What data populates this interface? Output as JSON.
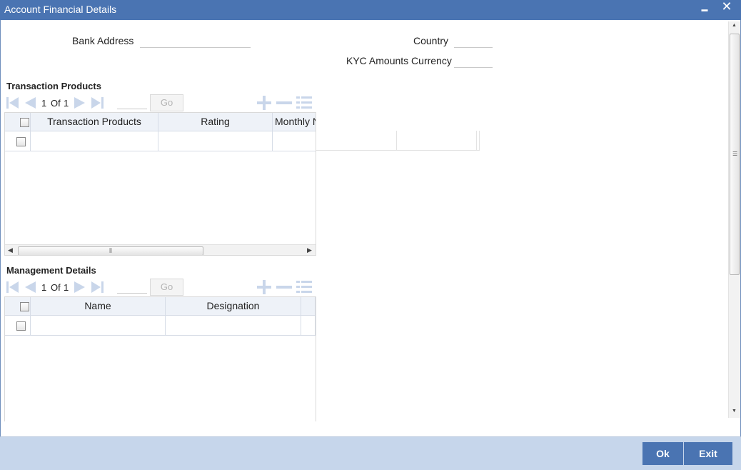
{
  "window": {
    "title": "Account Financial Details",
    "minimize_glyph": "▬",
    "close_glyph": "✕"
  },
  "form": {
    "bank_address_label": "Bank Address",
    "bank_address_value": "",
    "country_label": "Country",
    "country_value": "",
    "kyc_currency_label": "KYC Amounts Currency",
    "kyc_currency_value": ""
  },
  "transaction_products": {
    "title": "Transaction Products",
    "pager": {
      "current": "1",
      "of_label": "Of",
      "total": "1",
      "go_label": "Go"
    },
    "columns": [
      "Transaction Products",
      "Rating",
      "Monthly N"
    ],
    "rows": [
      {
        "transaction_product": "",
        "rating": "",
        "monthly": ""
      }
    ]
  },
  "management_details": {
    "title": "Management Details",
    "pager": {
      "current": "1",
      "of_label": "Of",
      "total": "1",
      "go_label": "Go"
    },
    "columns": [
      "Name",
      "Designation"
    ],
    "rows": [
      {
        "name": "",
        "designation": ""
      }
    ]
  },
  "icons": {
    "first": "first-page-icon",
    "prev": "previous-page-icon",
    "next": "next-page-icon",
    "last": "last-page-icon",
    "add": "add-row-icon",
    "delete": "delete-row-icon",
    "view": "single-view-icon"
  },
  "footer": {
    "ok_label": "Ok",
    "exit_label": "Exit"
  },
  "colors": {
    "titlebar": "#4a74b2",
    "footer": "#c6d6eb",
    "button": "#4a74b2",
    "disabled_icon": "#c9d6ea"
  }
}
